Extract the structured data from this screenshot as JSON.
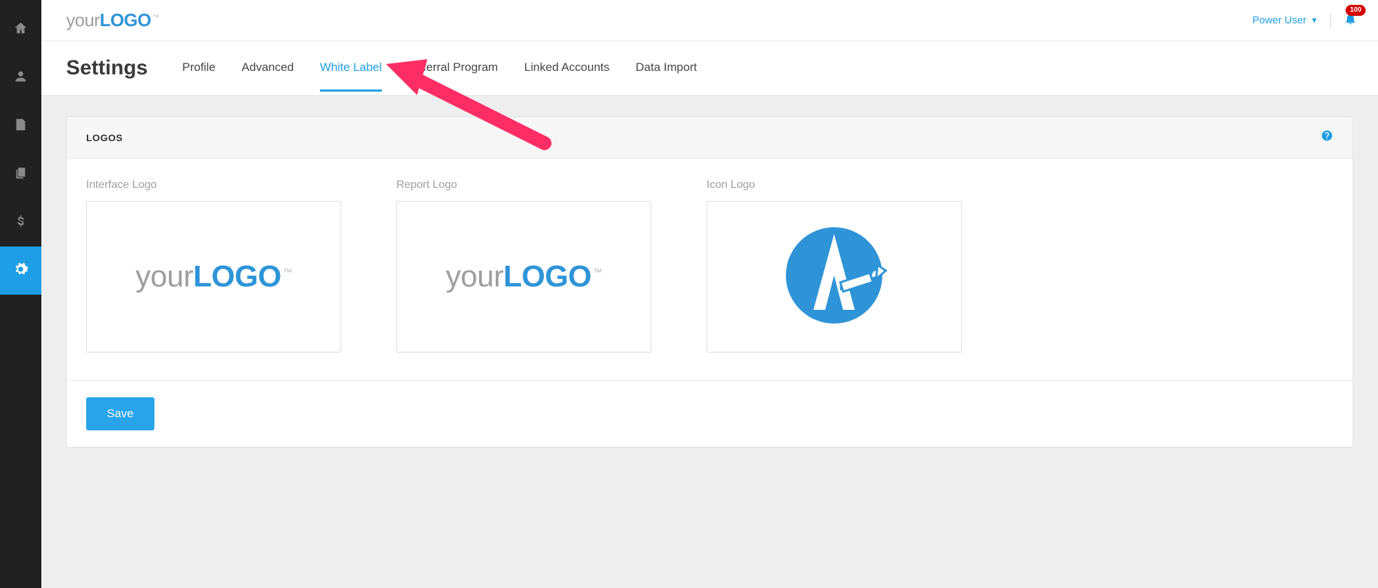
{
  "brand": {
    "prefix": "your",
    "suffix": "LOGO",
    "tm": "™"
  },
  "topbar": {
    "user_label": "Power User",
    "notification_count": "100"
  },
  "page": {
    "title": "Settings"
  },
  "tabs": [
    {
      "label": "Profile",
      "active": false
    },
    {
      "label": "Advanced",
      "active": false
    },
    {
      "label": "White Label",
      "active": true
    },
    {
      "label": "Referral Program",
      "active": false
    },
    {
      "label": "Linked Accounts",
      "active": false
    },
    {
      "label": "Data Import",
      "active": false
    }
  ],
  "panel": {
    "title": "LOGOS",
    "columns": {
      "interface_label": "Interface Logo",
      "report_label": "Report Logo",
      "icon_label": "Icon Logo"
    },
    "save_label": "Save"
  },
  "sidebar": {
    "items": [
      {
        "name": "home"
      },
      {
        "name": "user"
      },
      {
        "name": "report"
      },
      {
        "name": "copy"
      },
      {
        "name": "billing"
      },
      {
        "name": "settings",
        "active": true
      }
    ]
  }
}
